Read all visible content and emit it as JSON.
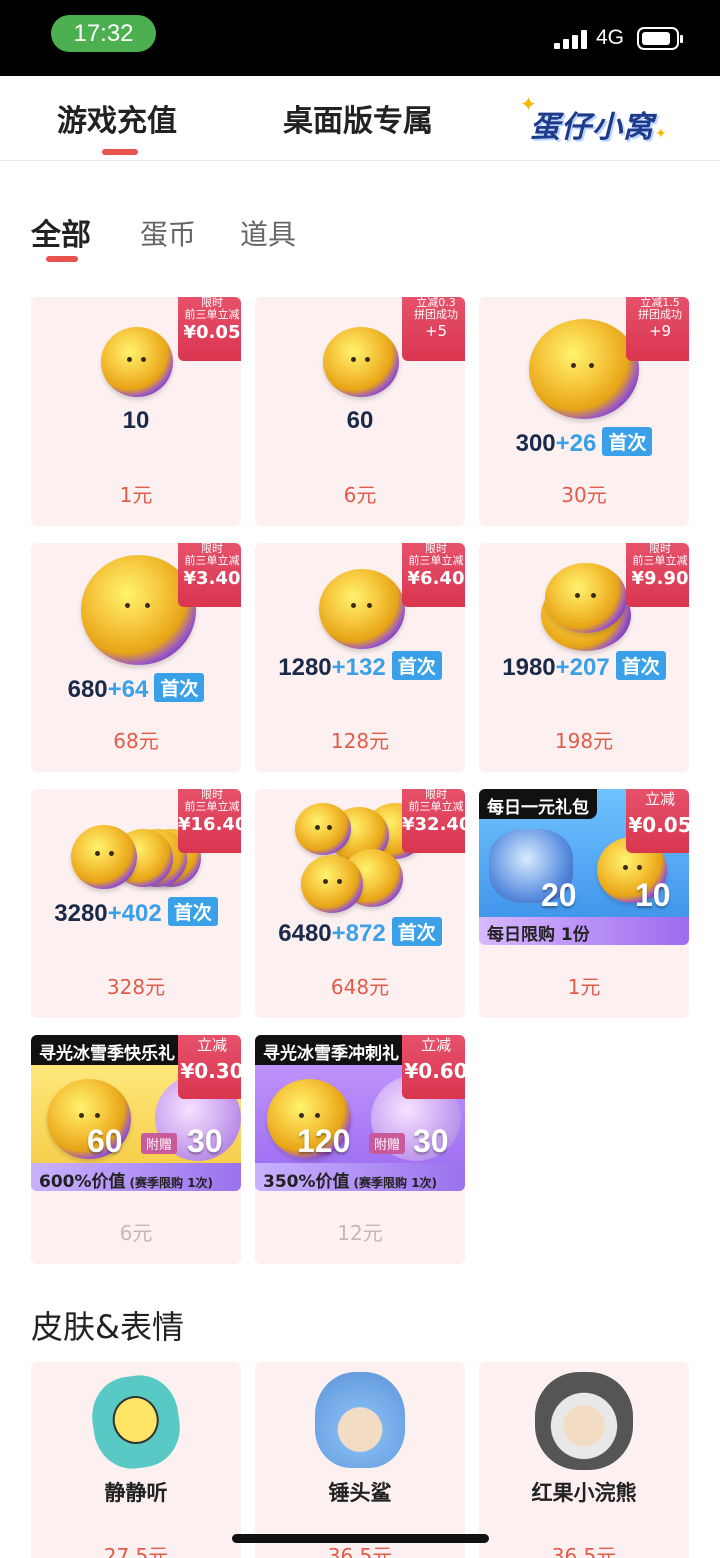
{
  "status_bar": {
    "time": "17:32",
    "network": "4G"
  },
  "top_tabs": {
    "game_recharge": "游戏充值",
    "desktop_exclusive": "桌面版专属",
    "brand": "蛋仔小窝"
  },
  "sub_tabs": {
    "all": "全部",
    "coins": "蛋币",
    "items": "道具"
  },
  "badges": {
    "limited_line1": "限时",
    "limited_line2": "前三单立减",
    "instant_discount": "立减",
    "group_success": "拼团成功"
  },
  "first_tag": "首次",
  "products": [
    {
      "amount": "10",
      "bonus": "",
      "price": "1元",
      "badge_type": "limited",
      "badge_amount": "¥0.05"
    },
    {
      "amount": "60",
      "bonus": "",
      "price": "6元",
      "badge_type": "group",
      "badge_top": "立减0.3",
      "badge_extra": "+5"
    },
    {
      "amount": "300",
      "bonus": "+26",
      "price": "30元",
      "badge_type": "group",
      "badge_top": "立减1.5",
      "badge_extra": "+9"
    },
    {
      "amount": "680",
      "bonus": "+64",
      "price": "68元",
      "badge_type": "limited",
      "badge_amount": "¥3.40"
    },
    {
      "amount": "1280",
      "bonus": "+132",
      "price": "128元",
      "badge_type": "limited",
      "badge_amount": "¥6.40"
    },
    {
      "amount": "1980",
      "bonus": "+207",
      "price": "198元",
      "badge_type": "limited",
      "badge_amount": "¥9.90"
    },
    {
      "amount": "3280",
      "bonus": "+402",
      "price": "328元",
      "badge_type": "limited",
      "badge_amount": "¥16.40"
    },
    {
      "amount": "6480",
      "bonus": "+872",
      "price": "648元",
      "badge_type": "limited",
      "badge_amount": "¥32.40"
    }
  ],
  "daily_pack": {
    "title": "每日一元礼包",
    "item_count": "20",
    "coin_count": "10",
    "strip": "每日限购 1份",
    "price": "1元",
    "badge_label": "立减",
    "badge_amount": "¥0.05"
  },
  "season_packs": [
    {
      "title": "寻光冰雪季快乐礼",
      "coins": "60",
      "gift_label": "附赠",
      "gift_count": "30",
      "value": "600%价值",
      "limit": "(赛季限购 1次)",
      "price": "6元",
      "badge_label": "立减",
      "badge_amount": "¥0.30"
    },
    {
      "title": "寻光冰雪季冲刺礼",
      "coins": "120",
      "gift_label": "附赠",
      "gift_count": "30",
      "value": "350%价值",
      "limit": "(赛季限购 1次)",
      "price": "12元",
      "badge_label": "立减",
      "badge_amount": "¥0.60"
    }
  ],
  "skins_section": {
    "title": "皮肤&表情",
    "items": [
      {
        "name": "静静听",
        "price": "27.5元"
      },
      {
        "name": "锤头鲨",
        "price": "36.5元"
      },
      {
        "name": "红果小浣熊",
        "price": "36.5元"
      }
    ]
  },
  "colors": {
    "accent_red": "#e8534f",
    "price_red": "#e25c4a",
    "card_bg": "#fcf0f0",
    "badge_red": "#d9354f",
    "bonus_blue": "#3aa0e8"
  }
}
